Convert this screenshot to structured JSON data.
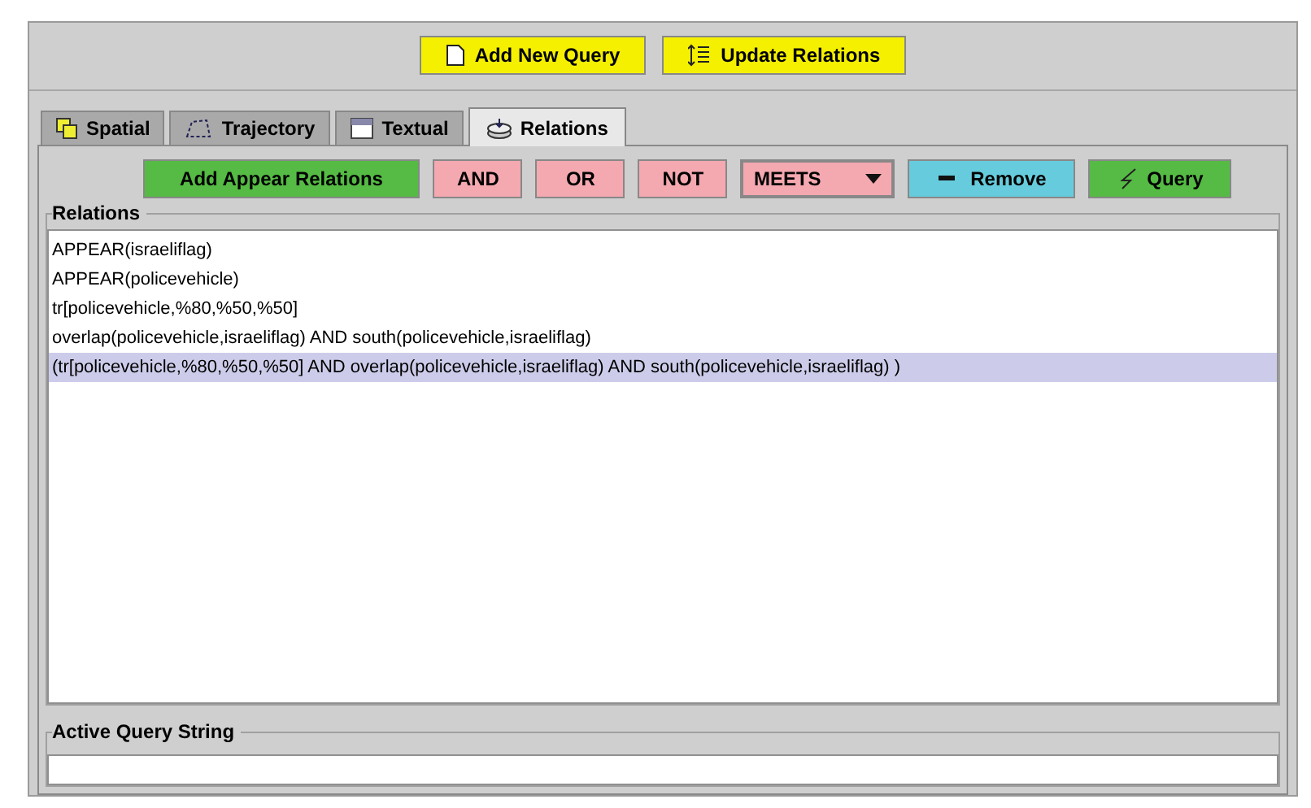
{
  "top_buttons": [
    {
      "kind": "add",
      "label": "Add New Query"
    },
    {
      "kind": "update",
      "label": "Update Relations"
    }
  ],
  "tabs": [
    {
      "kind": "spatial",
      "label": "Spatial",
      "selected": false
    },
    {
      "kind": "trajectory",
      "label": "Trajectory",
      "selected": false
    },
    {
      "kind": "textual",
      "label": "Textual",
      "selected": false
    },
    {
      "kind": "relations",
      "label": "Relations",
      "selected": true
    }
  ],
  "toolbar": [
    {
      "kind": "green",
      "label": "Add Appear Relations"
    },
    {
      "kind": "pink",
      "label": "AND"
    },
    {
      "kind": "pink",
      "label": "OR"
    },
    {
      "kind": "pink",
      "label": "NOT"
    },
    {
      "kind": "dropdown",
      "label": "MEETS"
    },
    {
      "kind": "remove",
      "label": "Remove"
    },
    {
      "kind": "query",
      "label": "Query"
    }
  ],
  "relations": {
    "title": "Relations",
    "items": [
      {
        "text": "APPEAR(israeliflag)",
        "selected": false
      },
      {
        "text": "APPEAR(policevehicle)",
        "selected": false
      },
      {
        "text": "tr[policevehicle,%80,%50,%50]",
        "selected": false
      },
      {
        "text": "overlap(policevehicle,israeliflag) AND south(policevehicle,israeliflag)",
        "selected": false
      },
      {
        "text": "(tr[policevehicle,%80,%50,%50] AND overlap(policevehicle,israeliflag) AND south(policevehicle,israeliflag) )",
        "selected": true
      }
    ]
  },
  "active_query": {
    "title": "Active Query String"
  }
}
